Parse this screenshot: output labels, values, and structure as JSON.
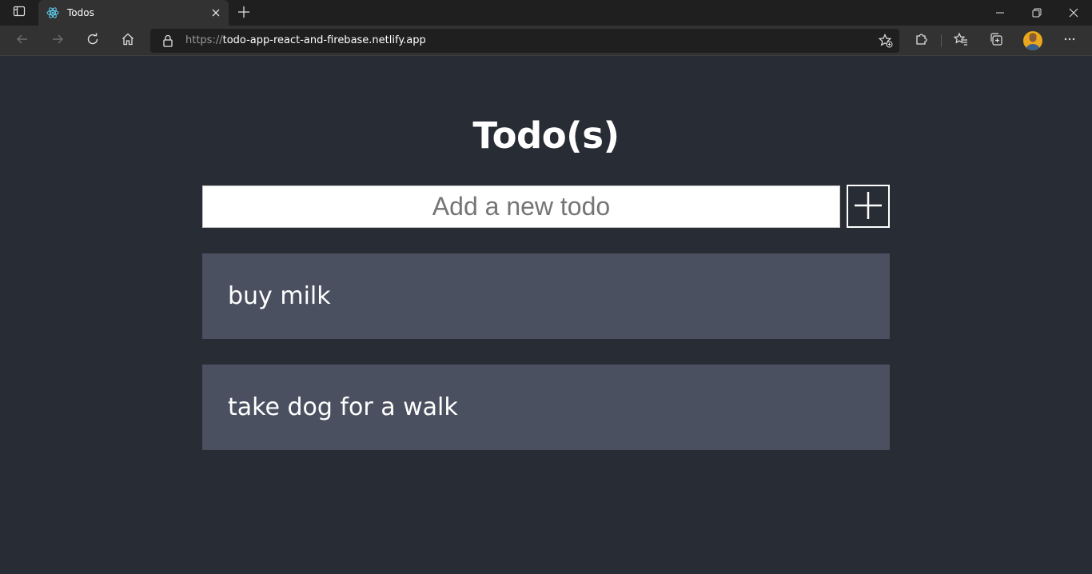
{
  "browser": {
    "tab": {
      "title": "Todos",
      "favicon": "react-icon"
    },
    "address_bar": {
      "scheme": "https://",
      "host": "todo-app-react-and-firebase.netlify.app"
    },
    "colors": {
      "titlebar": "#1f1f1f",
      "toolbar": "#323232",
      "profile": "#e8a71c"
    }
  },
  "app": {
    "title": "Todo(s)",
    "input": {
      "placeholder": "Add a new todo",
      "value": ""
    },
    "add_button_icon": "plus-icon",
    "todos": [
      {
        "text": "buy milk"
      },
      {
        "text": "take dog for a walk"
      }
    ],
    "colors": {
      "background": "#282c34",
      "todo_item": "#4a5060",
      "text": "#ffffff"
    }
  }
}
